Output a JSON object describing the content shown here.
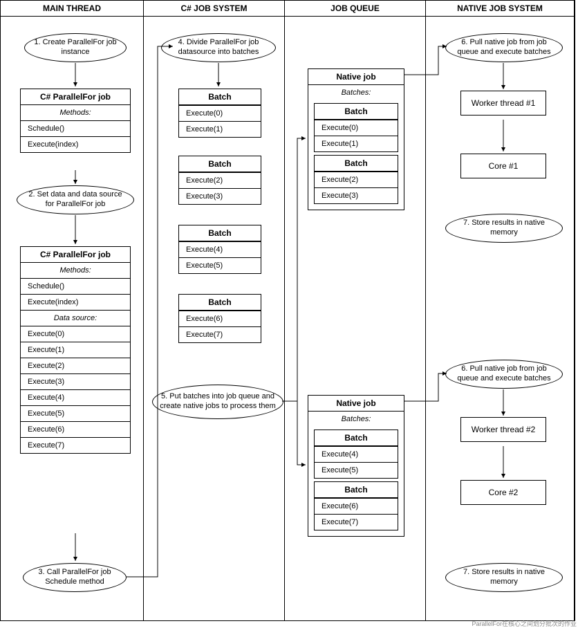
{
  "columns": {
    "c1": "MAIN THREAD",
    "c2": "C# JOB SYSTEM",
    "c3": "JOB QUEUE",
    "c4": "NATIVE JOB SYSTEM"
  },
  "main": {
    "step1": "1. Create ParallelFor job instance",
    "job1": {
      "title": "C# ParallelFor job",
      "sub": "Methods:",
      "rows": [
        "Schedule()",
        "Execute(index)"
      ]
    },
    "step2": "2. Set data and data source for ParallelFor job",
    "job2": {
      "title": "C# ParallelFor job",
      "sub": "Methods:",
      "mrows": [
        "Schedule()",
        "Execute(index)"
      ],
      "dsub": "Data source:",
      "drows": [
        "Execute(0)",
        "Execute(1)",
        "Execute(2)",
        "Execute(3)",
        "Execute(4)",
        "Execute(5)",
        "Execute(6)",
        "Execute(7)"
      ]
    },
    "step3": "3. Call ParallelFor job Schedule method"
  },
  "csjob": {
    "step4": "4. Divide ParallelFor job datasource into batches",
    "batches": [
      {
        "title": "Batch",
        "rows": [
          "Execute(0)",
          "Execute(1)"
        ]
      },
      {
        "title": "Batch",
        "rows": [
          "Execute(2)",
          "Execute(3)"
        ]
      },
      {
        "title": "Batch",
        "rows": [
          "Execute(4)",
          "Execute(5)"
        ]
      },
      {
        "title": "Batch",
        "rows": [
          "Execute(6)",
          "Execute(7)"
        ]
      }
    ],
    "step5": "5. Put batches into job queue and create native jobs to process them"
  },
  "queue": {
    "native1": {
      "title": "Native job",
      "sub": "Batches:",
      "b1": {
        "title": "Batch",
        "rows": [
          "Execute(0)",
          "Execute(1)"
        ]
      },
      "b2": {
        "title": "Batch",
        "rows": [
          "Execute(2)",
          "Execute(3)"
        ]
      }
    },
    "native2": {
      "title": "Native job",
      "sub": "Batches:",
      "b1": {
        "title": "Batch",
        "rows": [
          "Execute(4)",
          "Execute(5)"
        ]
      },
      "b2": {
        "title": "Batch",
        "rows": [
          "Execute(6)",
          "Execute(7)"
        ]
      }
    }
  },
  "native": {
    "step6a": "6. Pull native job from job queue and execute batches",
    "worker1": "Worker thread #1",
    "core1": "Core #1",
    "step7a": "7. Store results in native memory",
    "step6b": "6. Pull native job from job queue and execute batches",
    "worker2": "Worker thread #2",
    "core2": "Core #2",
    "step7b": "7. Store results in native memory"
  },
  "caption": "ParallelFor在核心之间划分批次的作业"
}
